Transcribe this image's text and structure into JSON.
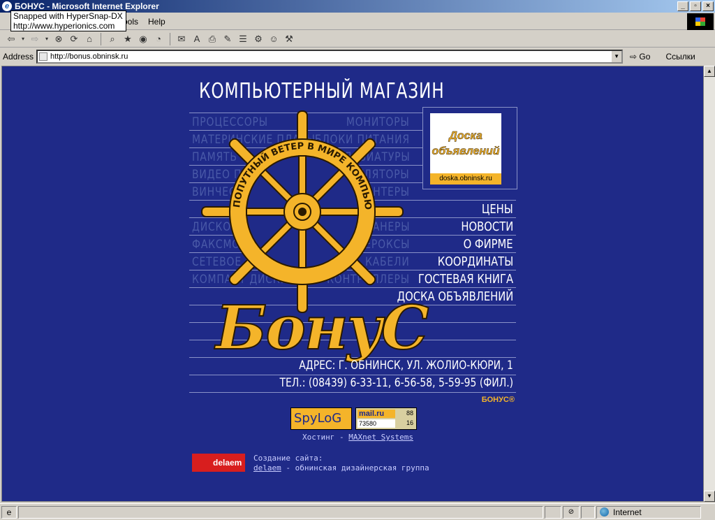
{
  "window": {
    "title": "БОНУС - Microsoft Internet Explorer"
  },
  "tooltip": {
    "line1": "Snapped with HyperSnap-DX",
    "line2": "http://www.hyperionics.com"
  },
  "menu": {
    "tools": "ools",
    "help": "Help"
  },
  "address": {
    "label": "Address",
    "url": "http://bonus.obninsk.ru",
    "go": "Go",
    "links": "Ссылки"
  },
  "status": {
    "zone": "Internet"
  },
  "page": {
    "heading": "КОМПЬЮТЕРНЫЙ МАГАЗИН",
    "categories_left": [
      "ПРОЦЕССОРЫ",
      "МАТЕРИНСКИЕ ПЛАТЫ",
      "ПАМЯТЬ",
      "ВИДЕО ПЛАТЫ",
      "ВИНЧЕСТЕРЫ",
      "",
      "ДИСКОВОДЫ",
      "ФАКСМОДЕМЫ",
      "СЕТЕВОЕ ОБОРУДОВАНИЕ",
      "КОМПАКТ ДИСКИ"
    ],
    "categories_right": [
      "МОНИТОРЫ",
      "БЛОКИ ПИТАНИЯ",
      "КЛАВИАТУРЫ",
      "МАНИПУЛЯТОРЫ",
      "ПРИНТЕРЫ",
      "",
      "СКАНЕРЫ",
      "КСЕРОКСЫ",
      "КАБЕЛИ",
      "КОНТРОЛЛЕРЫ"
    ],
    "wheel_text": "ПОПУТНЫЙ ВЕТЕР В МИРЕ КОМПЬЮТЕРОВ",
    "nav": [
      "ЦЕНЫ",
      "НОВОСТИ",
      "О ФИРМЕ",
      "КООРДИНАТЫ",
      "ГОСТЕВАЯ КНИГА",
      "ДОСКА ОБЪЯВЛЕНИЙ"
    ],
    "brand": "БонуС",
    "address_line": "АДРЕС: Г. ОБНИНСК, УЛ. ЖОЛИО-КЮРИ, 1",
    "phone_line": "ТЕЛ.: (08439) 6-33-11, 6-56-58, 5-59-95 (ФИЛ.)",
    "bonus_mark": "БОНУС®",
    "doska": {
      "title": "Доска объявлений",
      "url": "doska.obninsk.ru"
    },
    "counters": {
      "splog": "SpyLoG",
      "mail_logo": "mail.ru",
      "mail_value": "73580",
      "mail_top": "88",
      "mail_bottom": "16"
    },
    "hosting_prefix": "Хостинг - ",
    "hosting_link": "MAXnet Systems",
    "delaem_logo": "delaem",
    "credit_title": "Создание сайта:",
    "credit_link": "delaem",
    "credit_rest": " - обнинская дизайнерская группа"
  }
}
